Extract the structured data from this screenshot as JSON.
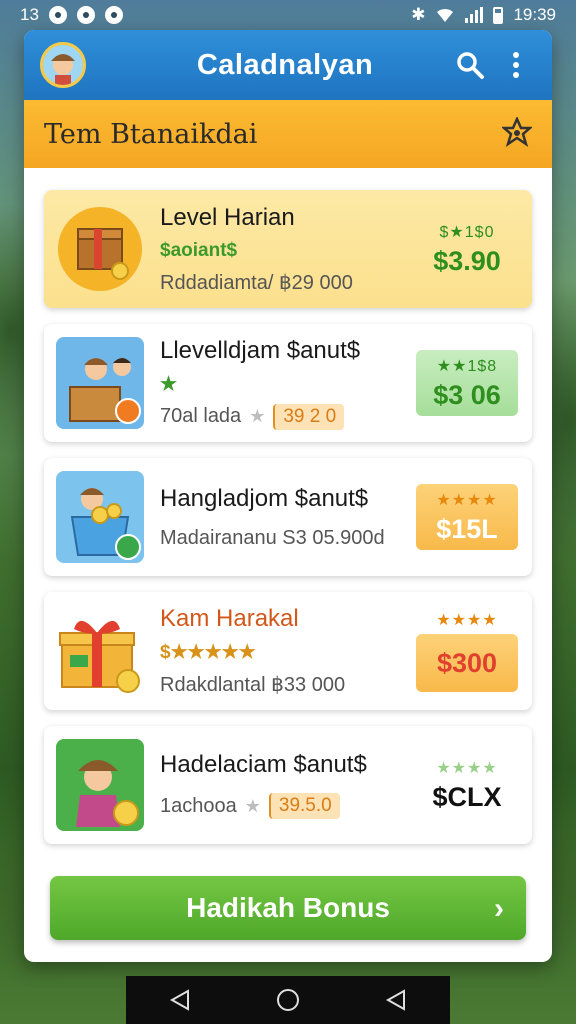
{
  "status": {
    "left_numbers": "13",
    "time": "19:39"
  },
  "app": {
    "title": "Caladnalyan"
  },
  "section": {
    "title": "Tem Btanaikdai"
  },
  "items": [
    {
      "title": "Level Harian",
      "sub": "$aoiant$",
      "desc": "Rddadiamta/ ฿29 000",
      "price_stars": "$★1$0",
      "price": "$3.90",
      "price_color": "#2e8f1e"
    },
    {
      "title": "Llevelldjam $anut$",
      "sub": "★",
      "desc": "70al lada",
      "chip": "39 2 0",
      "price_stars": "★★1$8",
      "price": "$3 06",
      "price_color": "#2e8f1e"
    },
    {
      "title": "Hangladjom $anut$",
      "sub": "",
      "desc": "Madairananu S3 05.900d",
      "price_stars": "★★★★",
      "price": "$15L"
    },
    {
      "title": "Kam Harakal",
      "sub": "$★★★★★",
      "desc": "Rdakdlantal ฿33 000",
      "price_stars": "★★★★",
      "price": "$300"
    },
    {
      "title": "Hadelaciam $anut$",
      "sub": "",
      "desc": "1achooa",
      "chip": "39.5.0",
      "price_stars": "★★★★",
      "price": "$CLX"
    }
  ],
  "cta": {
    "label": "Hadikah Bonus"
  }
}
